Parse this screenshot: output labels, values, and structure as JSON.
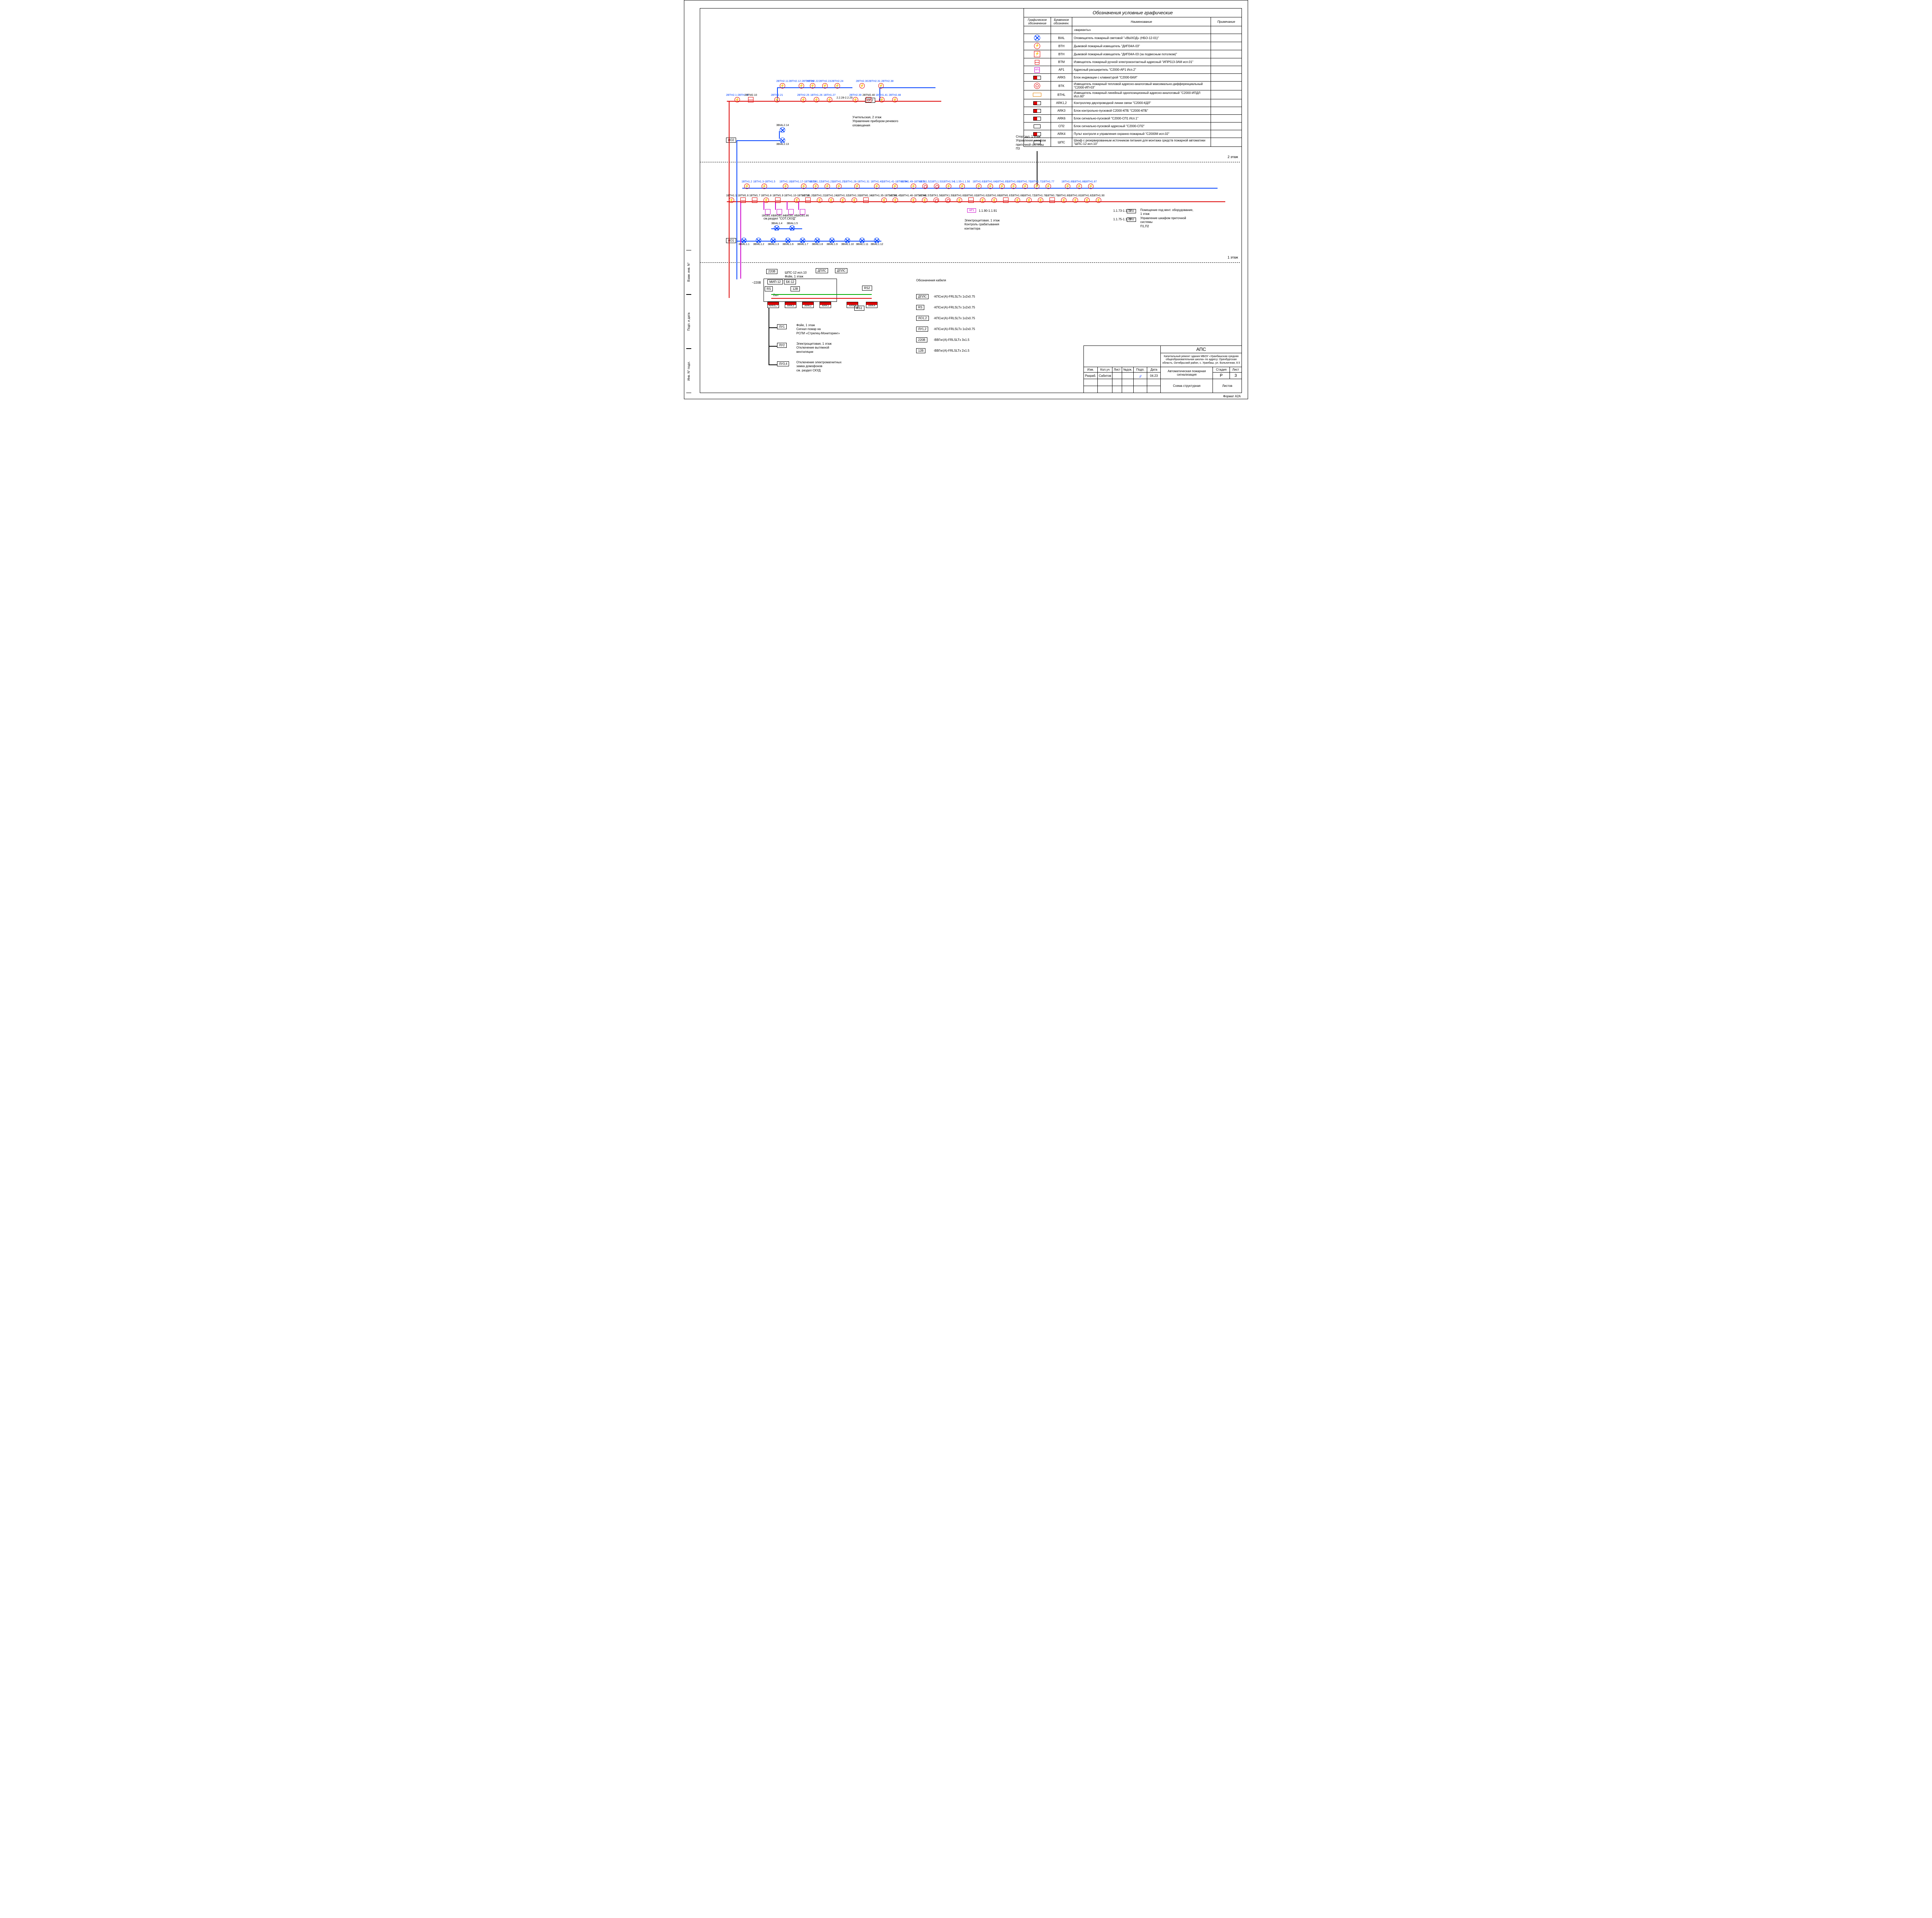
{
  "legend": {
    "title": "Обозначения условные графические",
    "headers": {
      "graphic": "Графическое\nобозначение",
      "letter": "Буквенное\nобозначен.",
      "name": "Наименование",
      "note": "Примечание"
    },
    "variants": "«варианты»",
    "rows": [
      {
        "sym": "circle-blue",
        "code": "BIAL",
        "name": "Оповещатель пожарный световой \"«ВЫХОД» (НБО-12-01)\""
      },
      {
        "sym": "circle-red",
        "glyph": "⚡",
        "code": "BTH",
        "name": "Дымовой пожарный извещатель \"ДИП34А-03\""
      },
      {
        "sym": "sq-red",
        "glyph": "⚡",
        "code": "BTH",
        "name": "Дымовой пожарный извещатель \"ДИП34А-03 (за подвесным потолком)\""
      },
      {
        "sym": "sq-red-empty",
        "glyph": "",
        "code": "BTM",
        "name": "Извещатель пожарный ручной электроконтактный адресный \"ИПР513-3АМ исп.01\""
      },
      {
        "sym": "sq-mag",
        "glyph": "АР1",
        "code": "AP1",
        "name": "Адресный расширитель \"С2000-АР1 Исп.2\""
      },
      {
        "sym": "blk-red",
        "code": "ARK5",
        "name": "Блок индикации с клавиатурой \"С2000-БКИ\""
      },
      {
        "sym": "circle-redplain",
        "code": "BTK",
        "name": "Извещатель пожарный тепловой адресно-аналоговый максимально-дифференциальный \"С2000-ИП-03\""
      },
      {
        "sym": "blk-orange",
        "code": "BTHL",
        "name": "Извещатель пожарный линейный однопозиционный адресно-аналоговый \"С2000-ИПДЛ Исп.60\""
      },
      {
        "sym": "blk-red",
        "code": "ARK1,2",
        "name": "Контроллер двухпроводной линии связи \"С2000-КДЛ\""
      },
      {
        "sym": "blk-red",
        "code": "ARK3",
        "name": "Блок контрольно-пусковой С2000-КПБ \"С2000-КПБ\""
      },
      {
        "sym": "blk-red",
        "code": "ARK6",
        "name": "Блок сигнально-пусковой \"С2000-СП1 Исп.1\""
      },
      {
        "sym": "sq-black",
        "glyph": "СП2",
        "code": "СП2",
        "name": "Блок сигнально-пусковой адресный \"С2000-СП2\""
      },
      {
        "sym": "blk-red",
        "code": "ARK4",
        "name": "Пульт контроля и управления охранно-пожарный \"С2000М исп.02\""
      },
      {
        "sym": "sq-black",
        "code": "ШПС",
        "name": "Шкаф с резервированным источником питания для монтажа средств пожарной автоматики \"ШПС-12 исп.10\""
      }
    ]
  },
  "floor2": {
    "label": "2 этаж",
    "row_top": [
      "2BTH2.11",
      "2BTH2.12-2BTH2.20",
      "2BTH2.22",
      "2BTH2.23",
      "2BTH2.24",
      "",
      "2BTH2.30",
      "2BTH2.31-2BTH2.38"
    ],
    "row_mid": [
      "2BTH2.1-2BTH2.9",
      "2BTM2.10",
      "",
      "2BTH2.21",
      "",
      "2BTH2.25",
      "1BTH1.26",
      "1BTH1.27",
      "2.2.28-2.2.29",
      "СП2",
      "2BTH2.39",
      "2BTM2.40",
      "1BTH1.41",
      "2BTH2.48"
    ],
    "note1": {
      "t1": "Учительская, 2 этаж",
      "t2": "Управление прибором речевого оповещения"
    },
    "note_sport": {
      "t1": "Спортзал, 1 этаж",
      "t2": "Управление шкафом приточной системы",
      "t3": "П3"
    },
    "bial": [
      "3BIAL2.14",
      "3BIAL2.13"
    ],
    "lo2": "ЛО2"
  },
  "floor1": {
    "label": "1 этаж",
    "row_top": [
      "1BTH1.2",
      "1BTH1.3-1BTH1.5",
      "",
      "1BTH1.16",
      "1BTH1.17-1BTH1.19",
      "1BTH1.22",
      "1BTH1.23",
      "1BTH1.25",
      "1BTH1.26-1BTH1.31",
      "",
      "1BTH1.40",
      "1BTH1.41-1BTH1.44",
      "1BTH1.49-1BTH1.51",
      "1BTL1.52",
      "1BTL1.53",
      "1BTH1.54",
      "1.1.55-1.1.56",
      "1BTH1.63",
      "1BTH1.64",
      "1BTH1.65",
      "1BTH1.69",
      "1BTH1.70",
      "1BTH1.71",
      "1BTH1.77",
      "",
      "1BTH1.89",
      "1BTH1.88",
      "1BTH1.87"
    ],
    "row_mid": [
      "1BTH1.1",
      "1BTM1.6",
      "1BTM1.7",
      "1BTH1.8",
      "1BTM1.9",
      "1BTH1.10-1BTH1.15",
      "1BTM1.20",
      "1BTH1.21",
      "1BTH1.24",
      "1BTH1.32",
      "1BTH1.33",
      "1BTM1.34",
      "1BTH1.35-1BTH1.39",
      "1BTH1.45",
      "1BTH1.46-1BTH1.48",
      "1BTH1.57",
      "1BTK1.58",
      "1BTK1.59",
      "1BTH1.60",
      "1BTM1.61",
      "1BTH1.62",
      "1BTH1.66",
      "1BTM1.67",
      "1BTH1.68",
      "1BTH1.72",
      "1BTH1.78",
      "1BTM1.79",
      "1BTH1.80",
      "1BTH1.81",
      "1BTH1.82",
      "1BTH1.90"
    ],
    "bgb": [
      "1BGB1.83",
      "1BGB1.84",
      "1BGB1.85",
      "1BGB1.86"
    ],
    "bgb_note": "см.раздел \"СОТ.СКУД\"",
    "bial_row1": [
      "3BIAL1.4",
      "3BIAL1.5"
    ],
    "bial_row2": [
      "3BIAL1.1",
      "3BIAL1.2",
      "3BIAL1.3",
      "3BIAL1.6",
      "3BIAL1.7",
      "3BIAL1.8",
      "3BIAL1.9",
      "3BIAL1.10",
      "3BIAL1.11",
      "3BIAL1.12"
    ],
    "lo1": "ЛО1",
    "ap1": "АР1",
    "ap1_nums": "1.1.90-1.1.91",
    "note_elec": {
      "t1": "Электрощитовая, 1 этаж",
      "t2": "Контроль срабатывания контактора"
    },
    "sp2_nums": [
      "1.1.73-1.1.74",
      "1.1.75-1.1.76"
    ],
    "note_vent": {
      "t1": "Помещение под вент. оборудование, 1 этаж",
      "t2": "Управление шкафом приточной системы",
      "t3": "П1,П2"
    }
  },
  "panel": {
    "shps": {
      "l1": "ШПС-12 исп.10",
      "l2": "Фойе, 1 этаж"
    },
    "v220": "220В",
    "v220n": "~220В",
    "mip": "МИП-12",
    "bk": "БК-12",
    "rs": "RS",
    "v12": "12В",
    "dpls": "ДПЛС",
    "rs1": "RS1",
    "rs2": "RS2",
    "qty": "2шт",
    "arks": [
      "ARK6,7",
      "ARK3",
      "ARK2",
      "ARK1",
      "ARK5",
      "ARK4"
    ],
    "lu": [
      "ЛУ1",
      "ЛУ2",
      "ЛУ3,4"
    ],
    "lu_notes": [
      {
        "t1": "Фойе, 1 этаж",
        "t2": "Сигнал пожар на",
        "t3": "РСПИ «Стрелец-Мониторинг»"
      },
      {
        "t1": "Электрощитовая, 1 этаж",
        "t2": "Отключение вытяжной",
        "t3": "вентиляции"
      },
      {
        "t1": "Отключение электромагнитных",
        "t2": "замка домофонов",
        "t3": "см. раздел СКУД"
      }
    ]
  },
  "cables": {
    "title": "Обозначения кабеля",
    "items": [
      {
        "tag": "ДПЛС",
        "spec": "-КПСнг(А)-FRLSLTx 1x2x0.75"
      },
      {
        "tag": "RS",
        "spec": "-КПСнг(А)-FRLSLTx 1x2x0.75"
      },
      {
        "tag": "ЛО1,2",
        "spec": "-КПСнг(А)-FRLSLTx 1x2x0.75"
      },
      {
        "tag": "ЛУ1,2",
        "spec": "-КПСнг(А)-FRLSLTx 1x2x0.75"
      },
      {
        "tag": "220В",
        "spec": "-ВВГнг(А)-FRLSLTx 3x1.5"
      },
      {
        "tag": "12В",
        "spec": "-ВВГнг(А)-FRLSLTx 2x1.5"
      }
    ]
  },
  "titleblock": {
    "project": "АПС",
    "desc": "Капитальный ремонт здания МБОУ «Уранбашская средняя общеобразовательная школа» по адресу: Оренбургская область, Октябрьский район, с. Уранбаш, ул. Больничная, 8.5",
    "system": "Автоматическая пожарная сигнализация",
    "drawing": "Схема структурная",
    "cols": {
      "izm": "Изм.",
      "kol": "Кол.уч",
      "list": "Лист",
      "ndoc": "№док.",
      "podp": "Подп.",
      "data": "Дата"
    },
    "dev": {
      "role": "Разраб.",
      "name": "Сабитов",
      "date": "04.23"
    },
    "stage": {
      "h": "Стадия",
      "v": "Р"
    },
    "sheet": {
      "h": "Лист",
      "v": "3"
    },
    "sheets": {
      "h": "Листов",
      "v": ""
    }
  },
  "side": {
    "inv": "Инв. N° подл.",
    "pd": "Подп. и дата",
    "vz": "Взам. инв. N°"
  },
  "format": "Формат А2А"
}
